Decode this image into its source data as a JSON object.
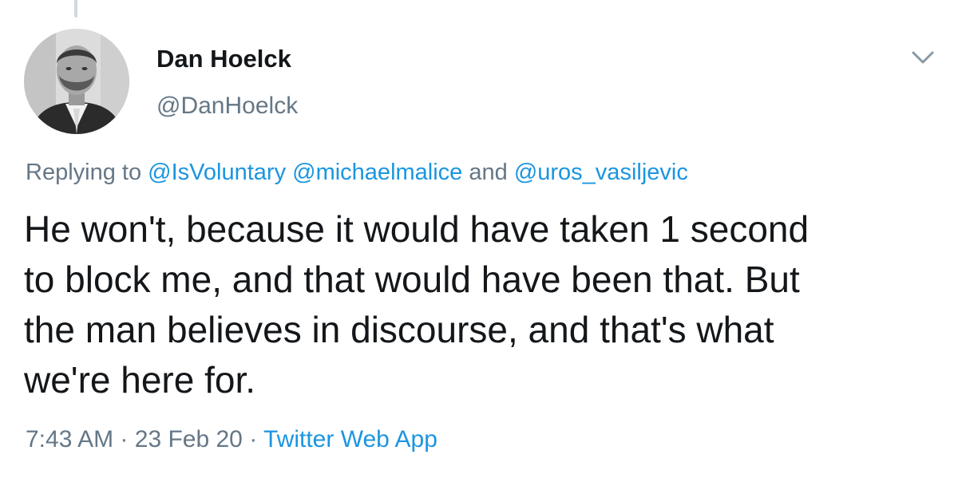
{
  "tweet": {
    "author": {
      "display_name": "Dan Hoelck",
      "handle": "@DanHoelck"
    },
    "reply": {
      "prefix": "Replying to",
      "mentions": [
        "@IsVoluntary",
        "@michaelmalice"
      ],
      "conjunction": "and",
      "last_mention": "@uros_vasiljevic"
    },
    "text_lines": [
      "He won't, because it would have taken 1 second",
      "to block me, and that would have been that. But",
      "the man believes in discourse, and that's what",
      "we're here for."
    ],
    "meta": {
      "time": "7:43 AM",
      "separator": "·",
      "date": "23 Feb 20",
      "source": "Twitter Web App"
    },
    "icons": {
      "menu": "chevron-down-icon",
      "avatar": "profile-photo"
    },
    "colors": {
      "link": "#1b95e0",
      "secondary": "#657786",
      "primary": "#14171a"
    }
  }
}
